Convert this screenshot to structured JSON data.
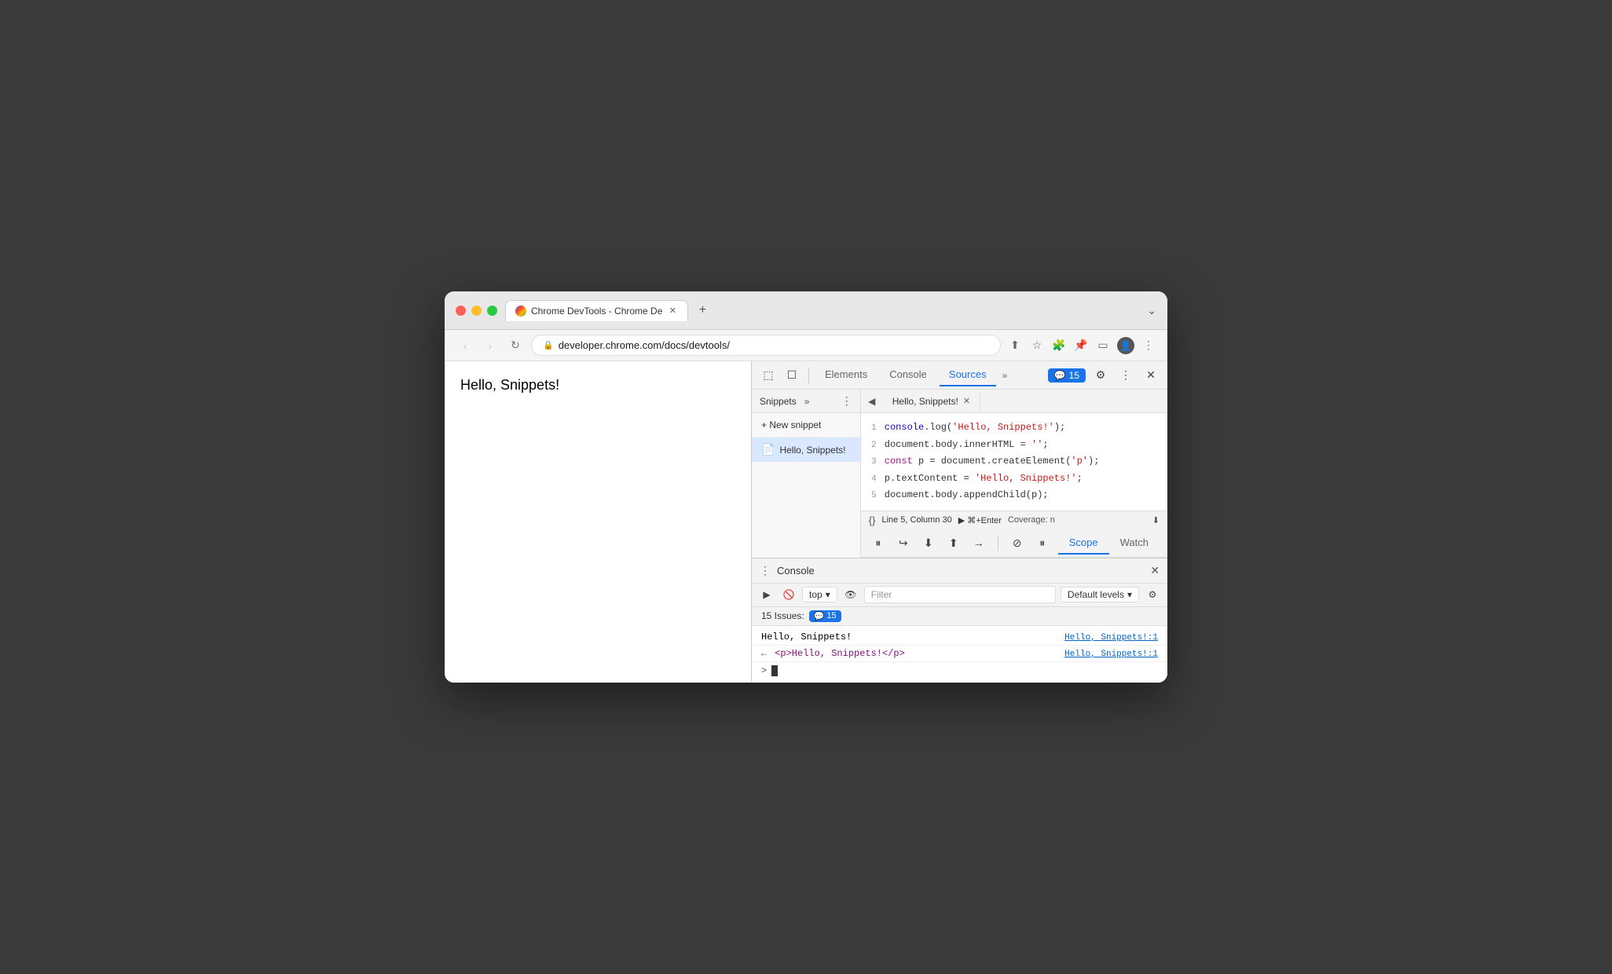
{
  "browser": {
    "tab_title": "Chrome DevTools - Chrome De",
    "url": "developer.chrome.com/docs/devtools/",
    "new_tab_label": "+",
    "chevron_label": "⌄"
  },
  "page": {
    "hello_text": "Hello, Snippets!"
  },
  "devtools": {
    "tabs": [
      {
        "label": "Elements"
      },
      {
        "label": "Console"
      },
      {
        "label": "Sources",
        "active": true
      },
      {
        "label": "»"
      }
    ],
    "issues_count": "15",
    "settings_label": "⚙",
    "more_label": "⋮",
    "close_label": "✕"
  },
  "snippets_panel": {
    "title": "Snippets",
    "more_btn": "»",
    "kebab_btn": "⋮",
    "new_snippet_label": "+ New snippet",
    "snippet_name": "Hello, Snippets!"
  },
  "editor": {
    "tab_label": "Hello, Snippets!",
    "code_lines": [
      {
        "num": "1",
        "content": "console.log('Hello, Snippets!');"
      },
      {
        "num": "2",
        "content": "document.body.innerHTML = '';"
      },
      {
        "num": "3",
        "content": "const p = document.createElement('p');"
      },
      {
        "num": "4",
        "content": "p.textContent = 'Hello, Snippets!';"
      },
      {
        "num": "5",
        "content": "document.body.appendChild(p);"
      }
    ],
    "status_format": "{}",
    "status_line": "Line 5, Column 30",
    "run_label": "▶ ⌘+Enter",
    "coverage_label": "Coverage: n",
    "expand_label": "⬇"
  },
  "debugger": {
    "scope_label": "Scope",
    "watch_label": "Watch"
  },
  "console": {
    "title": "Console",
    "close_label": "✕",
    "run_btn": "▶",
    "block_btn": "🚫",
    "context_label": "top",
    "eye_icon": "👁",
    "filter_placeholder": "Filter",
    "levels_label": "Default levels",
    "gear_label": "⚙",
    "issues_label": "15 Issues:",
    "issues_count": "15",
    "lines": [
      {
        "text": "Hello, Snippets!",
        "link": "Hello, Snippets!:1"
      }
    ],
    "dom_line": {
      "arrow": "←",
      "content": "<p>Hello, Snippets!</p>",
      "link": "Hello, Snippets!:1"
    },
    "input_prompt": ">",
    "input_cursor": "|"
  }
}
